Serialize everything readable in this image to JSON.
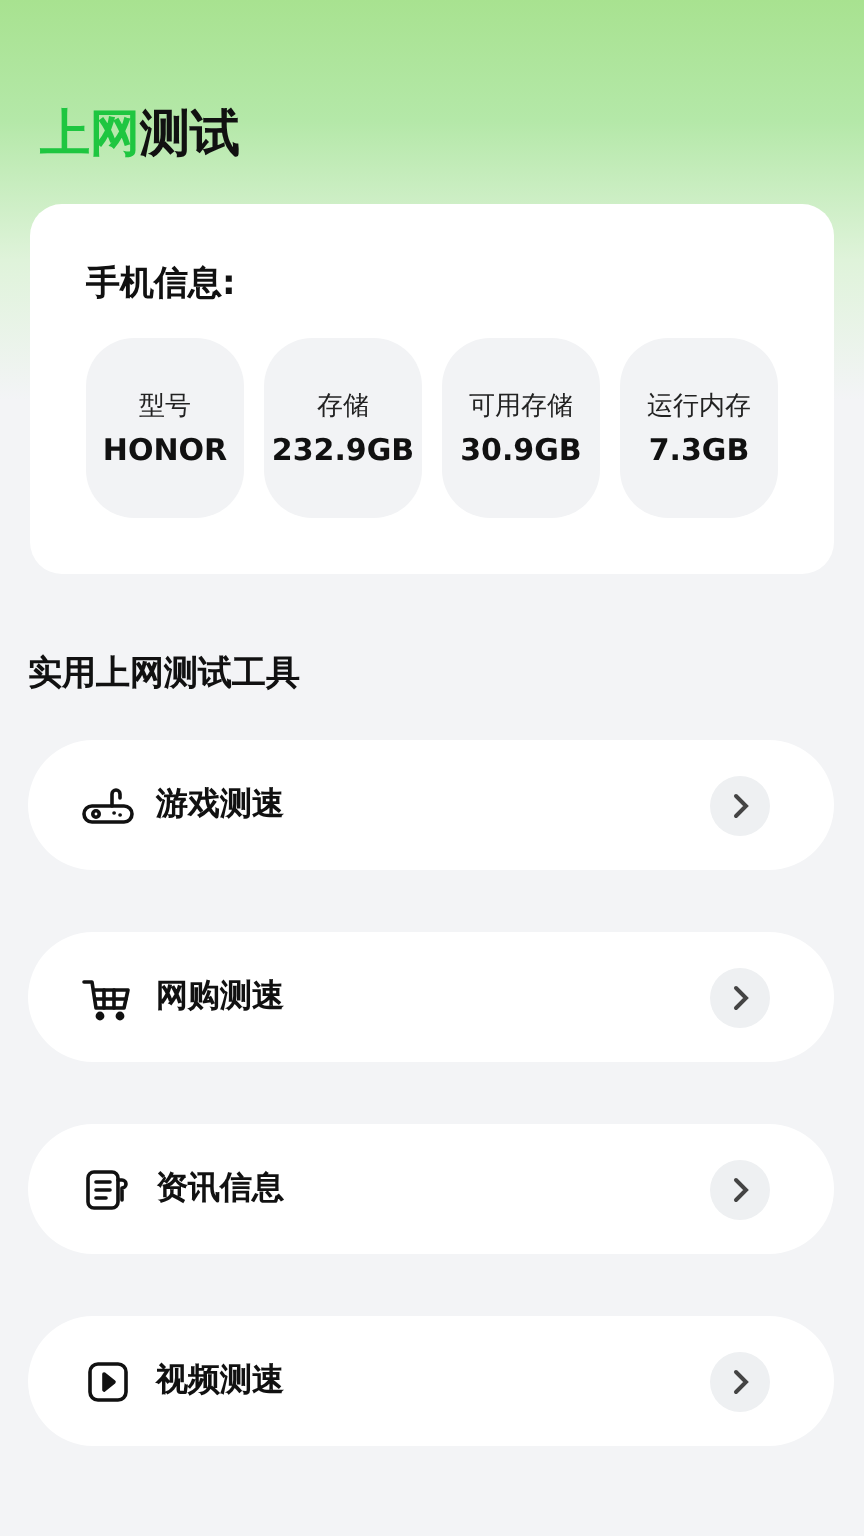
{
  "title": {
    "accent": "上网",
    "rest": "测试"
  },
  "phone_info": {
    "heading": "手机信息:",
    "stats": [
      {
        "label": "型号",
        "value": "HONOR"
      },
      {
        "label": "存储",
        "value": "232.9GB"
      },
      {
        "label": "可用存储",
        "value": "30.9GB"
      },
      {
        "label": "运行内存",
        "value": "7.3GB"
      }
    ]
  },
  "tools": {
    "heading": "实用上网测试工具",
    "items": [
      {
        "kind": "game",
        "label": "游戏测速"
      },
      {
        "kind": "shop",
        "label": "网购测速"
      },
      {
        "kind": "news",
        "label": "资讯信息"
      },
      {
        "kind": "video",
        "label": "视频测速"
      }
    ]
  }
}
